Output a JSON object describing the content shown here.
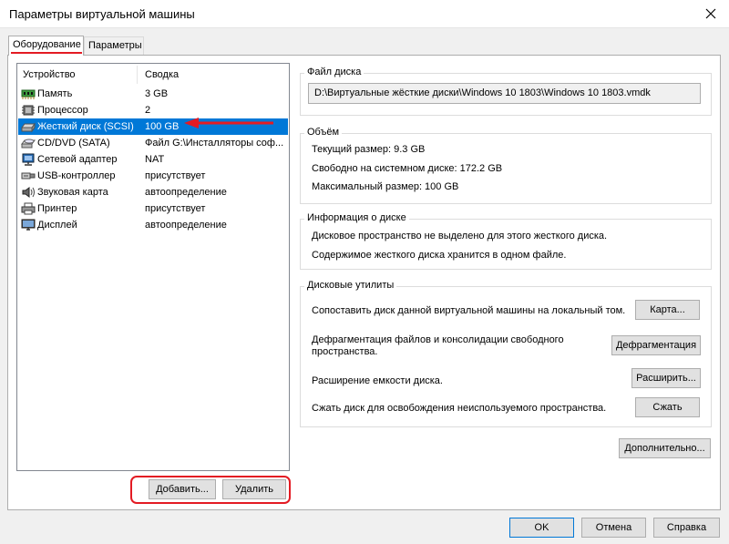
{
  "window": {
    "title": "Параметры виртуальной машины",
    "close_icon": "close-icon"
  },
  "tabs": [
    {
      "label": "Оборудование",
      "active": true
    },
    {
      "label": "Параметры",
      "active": false
    }
  ],
  "device_list": {
    "columns": [
      "Устройство",
      "Сводка"
    ],
    "rows": [
      {
        "icon": "memory-icon",
        "name": "Память",
        "summary": "3 GB",
        "selected": false
      },
      {
        "icon": "processor-icon",
        "name": "Процессор",
        "summary": "2",
        "selected": false
      },
      {
        "icon": "hard-disk-icon",
        "name": "Жесткий диск (SCSI)",
        "summary": "100 GB",
        "selected": true
      },
      {
        "icon": "cd-dvd-icon",
        "name": "CD/DVD (SATA)",
        "summary": "Файл G:\\Инсталляторы соф...",
        "selected": false
      },
      {
        "icon": "network-adapter-icon",
        "name": "Сетевой адаптер",
        "summary": "NAT",
        "selected": false
      },
      {
        "icon": "usb-icon",
        "name": "USB-контроллер",
        "summary": "присутствует",
        "selected": false
      },
      {
        "icon": "sound-card-icon",
        "name": "Звуковая карта",
        "summary": "автоопределение",
        "selected": false
      },
      {
        "icon": "printer-icon",
        "name": "Принтер",
        "summary": "присутствует",
        "selected": false
      },
      {
        "icon": "display-icon",
        "name": "Дисплей",
        "summary": "автоопределение",
        "selected": false
      }
    ],
    "add_label": "Добавить...",
    "remove_label": "Удалить"
  },
  "disk_file": {
    "group_label": "Файл диска",
    "path": "D:\\Виртуальные жёсткие диски\\Windows 10 1803\\Windows 10 1803.vmdk"
  },
  "capacity": {
    "group_label": "Объём",
    "current": "Текущий размер: 9.3 GB",
    "free": "Свободно на системном диске: 172.2 GB",
    "max": "Максимальный размер: 100 GB"
  },
  "disk_info": {
    "group_label": "Информация о диске",
    "line1": "Дисковое пространство не выделено для этого жесткого диска.",
    "line2": "Содержимое жесткого диска хранится в одном файле."
  },
  "utilities": {
    "group_label": "Дисковые утилиты",
    "map_text": "Сопоставить диск данной виртуальной машины на локальный том.",
    "map_button": "Карта...",
    "defrag_text_1": "Дефрагментация файлов и консолидации свободного",
    "defrag_text_2": "пространства.",
    "defrag_button": "Дефрагментация",
    "expand_text": "Расширение емкости диска.",
    "expand_button": "Расширить...",
    "compact_text": "Сжать диск для освобождения неиспользуемого пространства.",
    "compact_button": "Сжать"
  },
  "advanced_button": "Дополнительно...",
  "footer": {
    "ok": "OK",
    "cancel": "Отмена",
    "help": "Справка"
  },
  "annotation_color": "#e31b23",
  "selection_color": "#0078d7"
}
